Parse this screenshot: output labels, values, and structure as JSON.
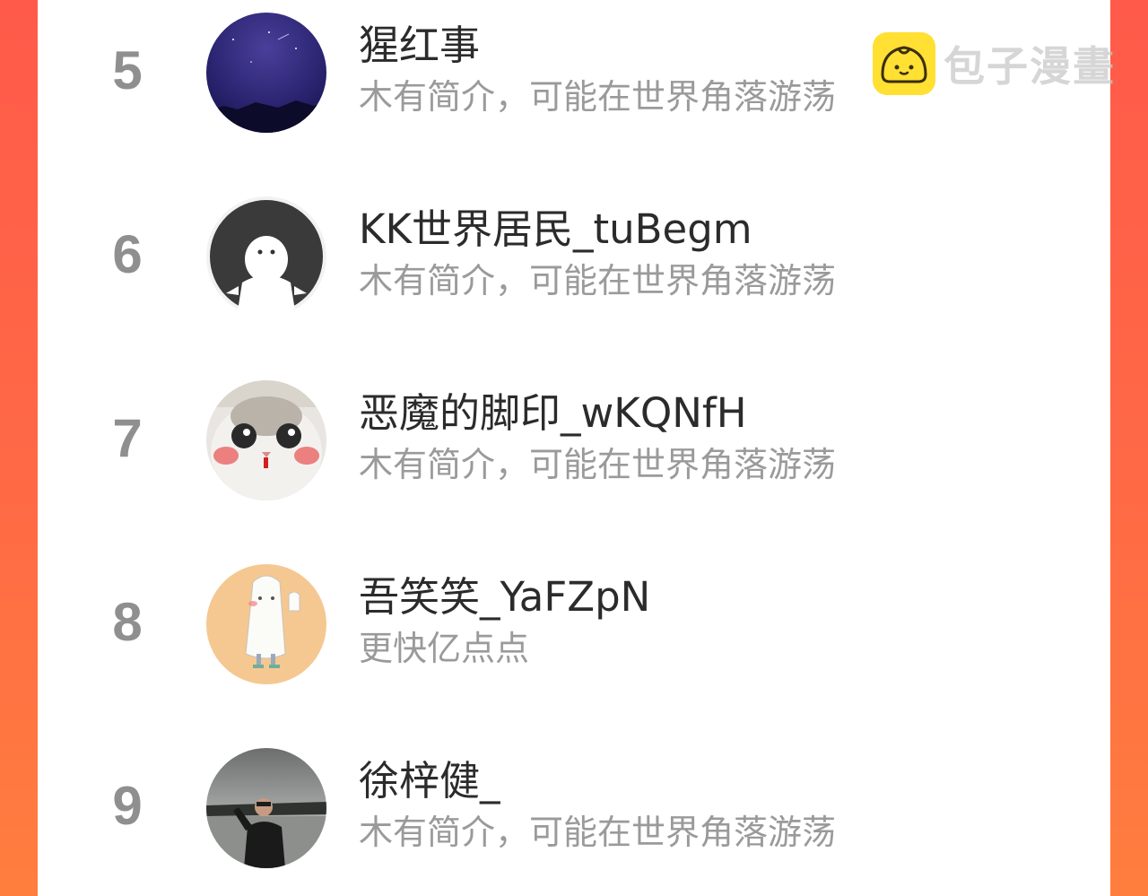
{
  "watermark": {
    "text": "包子漫畫",
    "icon": "bun-logo-icon"
  },
  "ranking": [
    {
      "rank": "5",
      "name": "猩红事",
      "bio": "木有简介，可能在世界角落游荡",
      "avatar": "night-sky-avatar"
    },
    {
      "rank": "6",
      "name": "KK世界居民_tuBegm",
      "bio": "木有简介，可能在世界角落游荡",
      "avatar": "default-ghost-avatar"
    },
    {
      "rank": "7",
      "name": "恶魔的脚印_wKQNfH",
      "bio": "木有简介，可能在世界角落游荡",
      "avatar": "cat-face-avatar"
    },
    {
      "rank": "8",
      "name": "吾笑笑_YaFZpN",
      "bio": "更快亿点点",
      "avatar": "sheet-ghost-avatar"
    },
    {
      "rank": "9",
      "name": "徐梓健_",
      "bio": "木有简介，可能在世界角落游荡",
      "avatar": "outdoor-photo-avatar"
    }
  ],
  "colors": {
    "background_gradient_top": "#ff5a4a",
    "background_gradient_bottom": "#ff7e3e",
    "panel": "#ffffff",
    "rank_number": "#8f8f8f",
    "name_text": "#2b2b2b",
    "bio_text": "#9a9a9a",
    "logo_yellow": "#ffe033"
  }
}
